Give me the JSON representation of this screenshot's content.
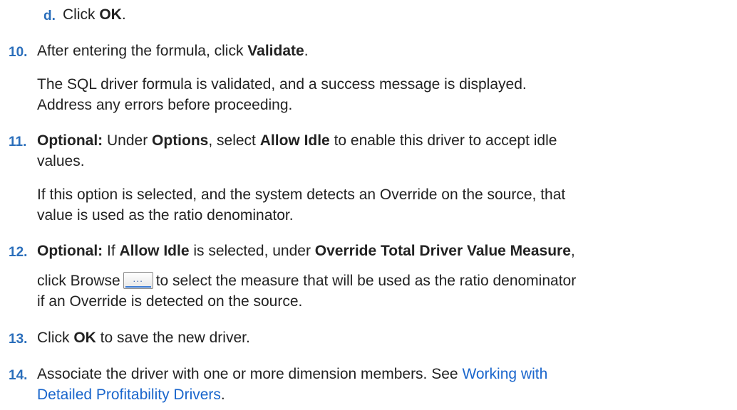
{
  "steps": {
    "d": {
      "num": "d.",
      "pre": "Click ",
      "bold": "OK",
      "post": "."
    },
    "s10": {
      "num": "10.",
      "pre": "After entering the formula, click ",
      "bold": "Validate",
      "post": ".",
      "p1": "The SQL driver formula is validated, and a success message is displayed.",
      "p2": "Address any errors before proceeding."
    },
    "s11": {
      "num": "11.",
      "b1": "Optional:",
      "t1": " Under ",
      "b2": "Options",
      "t2": ", select ",
      "b3": "Allow Idle",
      "t3": " to enable this driver to accept idle",
      "l2": "values.",
      "p1": "If this option is selected, and the system detects an Override on the source, that",
      "p2": "value is used as the ratio denominator."
    },
    "s12": {
      "num": "12.",
      "b1": "Optional:",
      "t1": " If ",
      "b2": "Allow Idle",
      "t2": " is selected, under ",
      "b3": "Override Total Driver Value Measure",
      "t3": ",",
      "l2a": "click Browse",
      "l2b": "to select the measure that will be used as the ratio denominator",
      "l3": "if an Override is detected on the source.",
      "button_icon": "ellipsis-icon",
      "button_text": "..."
    },
    "s13": {
      "num": "13.",
      "pre": "Click ",
      "bold": "OK",
      "post": " to save the new driver."
    },
    "s14": {
      "num": "14.",
      "pre": "Associate the driver with one or more dimension members. See ",
      "link1": "Working with",
      "link2": "Detailed Profitability Drivers",
      "post": "."
    }
  }
}
